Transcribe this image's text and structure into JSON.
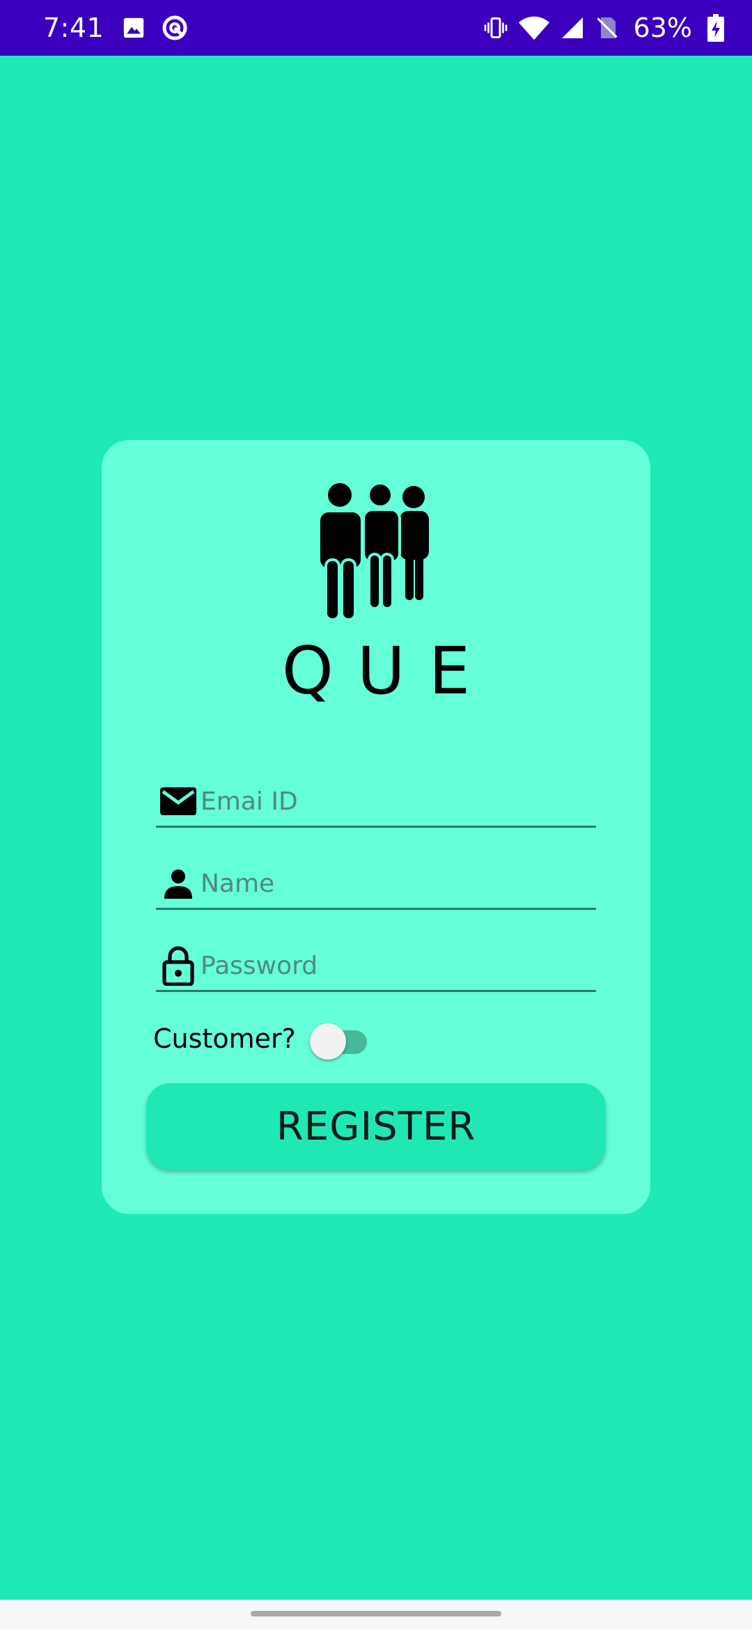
{
  "status_bar": {
    "time": "7:41",
    "battery_percent": "63%",
    "icons_left": [
      "image-icon",
      "sync-circle-icon"
    ],
    "icons_right": [
      "vibrate-icon",
      "wifi-icon",
      "cell-signal-icon",
      "no-sim-icon",
      "battery-charging-icon"
    ],
    "background": "#3a00bd"
  },
  "app": {
    "logo_icon": "people-group-icon",
    "logo_text": "QUE",
    "background": "#1feab7",
    "card_color": "#64fed9"
  },
  "form": {
    "email": {
      "icon": "mail-icon",
      "placeholder": "Emai ID",
      "value": ""
    },
    "name": {
      "icon": "person-icon",
      "placeholder": "Name",
      "value": ""
    },
    "password": {
      "icon": "lock-icon",
      "placeholder": "Password",
      "value": ""
    },
    "customer_label": "Customer?",
    "customer_toggle_on": false,
    "register_label": "REGISTER"
  }
}
